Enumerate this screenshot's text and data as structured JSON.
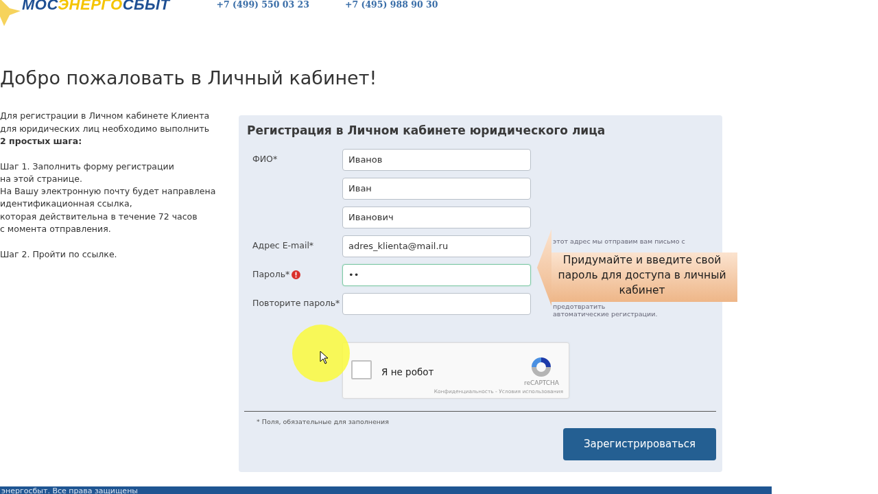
{
  "header": {
    "logo": {
      "part1": "МОС",
      "part2": "ЭНЕРГО",
      "part3": "СБЫТ"
    },
    "phones": [
      "+7 (499) 550 03 23",
      "+7 (495) 988 90 30"
    ]
  },
  "page_title": "Добро пожаловать в Личный кабинет!",
  "intro": {
    "paragraphs": [
      {
        "lines": [
          "Для регистрации в Личном кабинете Клиента",
          "для юридических лиц необходимо выполнить",
          "**2 простых шага:**"
        ]
      },
      {
        "lines": [
          "Шаг 1. Заполнить форму регистрации",
          "на этой странице.",
          "На Вашу электронную почту будет направлена",
          "идентификационная ссылка,",
          "которая действительна в течение 72 часов",
          "с момента отправления."
        ]
      },
      {
        "lines": [
          "Шаг 2. Пройти по ссылке."
        ]
      }
    ]
  },
  "form": {
    "title": "Регистрация в Личном кабинете юридического лица",
    "rows": [
      {
        "label": "ФИО*",
        "value": "Иванов",
        "focused": false,
        "error": false
      },
      {
        "value": "Иван",
        "focused": false,
        "error": false
      },
      {
        "value": "Иванович",
        "focused": false,
        "error": false
      },
      {
        "label": "Адрес E-mail*",
        "value": "adres_klienta@mail.ru",
        "focused": false,
        "error": false,
        "hint": "этот адрес мы отправим вам письмо с"
      },
      {
        "label": "Пароль*",
        "value": "••",
        "focused": true,
        "error": true
      },
      {
        "label": "Повторите пароль*",
        "value": "",
        "focused": false,
        "error": false,
        "hint": "предотвратить автоматические регистрации."
      }
    ],
    "captcha": {
      "label": "Я не робот",
      "checked": false,
      "brand": "reCAPTCHA",
      "links": "Конфиденциальность - Условия использования"
    },
    "required_note": "* Поля, обязательные для заполнения",
    "submit": "Зарегистрироваться"
  },
  "callout": "Придумайте и введите свой пароль для доступа в личный кабинет",
  "footer": "энергосбыт. Все права защищены"
}
